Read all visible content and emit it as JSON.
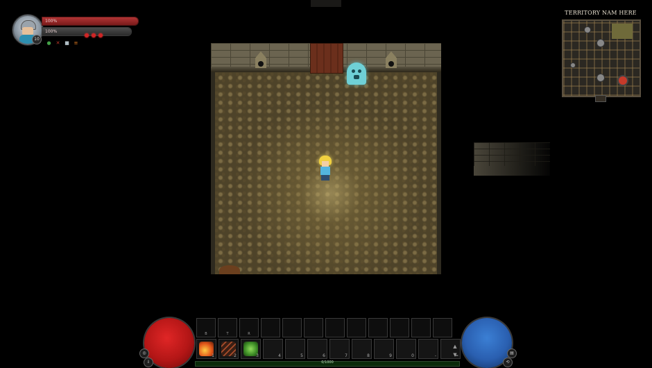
{
  "player": {
    "health_text": "100%",
    "mana_text": "100%",
    "level": "10",
    "health_fraction": 1.0,
    "mana_fraction": 1.0,
    "stamina_dots": 3,
    "status_icons": [
      {
        "name": "shield-icon",
        "glyph": "●",
        "color": "#43a047"
      },
      {
        "name": "dagger-icon",
        "glyph": "✕",
        "color": "#c0392b"
      },
      {
        "name": "potion-icon",
        "glyph": "■",
        "color": "#b0bec5"
      },
      {
        "name": "scroll-icon",
        "glyph": "≡",
        "color": "#e67e22"
      }
    ]
  },
  "minimap": {
    "title": "TERRITORY NAM HERE"
  },
  "hotbar": {
    "top_keys": [
      "B",
      "T",
      "R",
      "",
      "",
      "",
      "",
      "",
      "",
      "",
      "",
      ""
    ],
    "skill_numbers": [
      "1",
      "2",
      "3",
      "4",
      "5",
      "6",
      "7",
      "8",
      "9",
      "0",
      "-",
      "="
    ],
    "skill_icons": [
      "fire-claw-icon",
      "beast-claw-icon",
      "nature-leaf-icon"
    ],
    "xp_text": "0/1000",
    "xp_fraction": 0.0,
    "left_orb_buttons": [
      "◎",
      "⇩"
    ],
    "right_orb_buttons": [
      "▤",
      "⟲"
    ],
    "arrows": [
      "▲",
      "▼"
    ]
  },
  "colors": {
    "health": "#d21f1f",
    "mana": "#2f64b6",
    "xp": "#3a8a2a"
  }
}
